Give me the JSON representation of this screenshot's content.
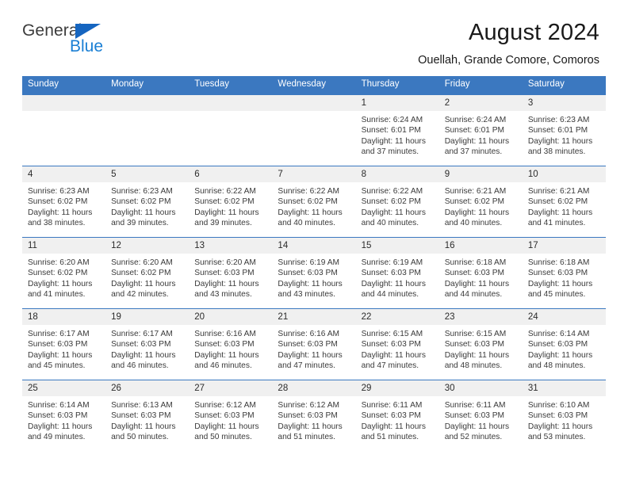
{
  "brand": {
    "general": "General",
    "blue": "Blue",
    "flag_icon": "triangle-flag-icon",
    "accent_color": "#1a7fd4"
  },
  "header": {
    "title": "August 2024",
    "location": "Ouellah, Grande Comore, Comoros"
  },
  "theme": {
    "header_blue": "#3b78c0",
    "daynum_bg": "#f0f0f0",
    "text": "#3a3a3a"
  },
  "weekday_headers": [
    "Sunday",
    "Monday",
    "Tuesday",
    "Wednesday",
    "Thursday",
    "Friday",
    "Saturday"
  ],
  "weeks": [
    [
      {
        "day": "",
        "sunrise": "",
        "sunset": "",
        "daylight_line1": "",
        "daylight_line2": ""
      },
      {
        "day": "",
        "sunrise": "",
        "sunset": "",
        "daylight_line1": "",
        "daylight_line2": ""
      },
      {
        "day": "",
        "sunrise": "",
        "sunset": "",
        "daylight_line1": "",
        "daylight_line2": ""
      },
      {
        "day": "",
        "sunrise": "",
        "sunset": "",
        "daylight_line1": "",
        "daylight_line2": ""
      },
      {
        "day": "1",
        "sunrise": "Sunrise: 6:24 AM",
        "sunset": "Sunset: 6:01 PM",
        "daylight_line1": "Daylight: 11 hours",
        "daylight_line2": "and 37 minutes."
      },
      {
        "day": "2",
        "sunrise": "Sunrise: 6:24 AM",
        "sunset": "Sunset: 6:01 PM",
        "daylight_line1": "Daylight: 11 hours",
        "daylight_line2": "and 37 minutes."
      },
      {
        "day": "3",
        "sunrise": "Sunrise: 6:23 AM",
        "sunset": "Sunset: 6:01 PM",
        "daylight_line1": "Daylight: 11 hours",
        "daylight_line2": "and 38 minutes."
      }
    ],
    [
      {
        "day": "4",
        "sunrise": "Sunrise: 6:23 AM",
        "sunset": "Sunset: 6:02 PM",
        "daylight_line1": "Daylight: 11 hours",
        "daylight_line2": "and 38 minutes."
      },
      {
        "day": "5",
        "sunrise": "Sunrise: 6:23 AM",
        "sunset": "Sunset: 6:02 PM",
        "daylight_line1": "Daylight: 11 hours",
        "daylight_line2": "and 39 minutes."
      },
      {
        "day": "6",
        "sunrise": "Sunrise: 6:22 AM",
        "sunset": "Sunset: 6:02 PM",
        "daylight_line1": "Daylight: 11 hours",
        "daylight_line2": "and 39 minutes."
      },
      {
        "day": "7",
        "sunrise": "Sunrise: 6:22 AM",
        "sunset": "Sunset: 6:02 PM",
        "daylight_line1": "Daylight: 11 hours",
        "daylight_line2": "and 40 minutes."
      },
      {
        "day": "8",
        "sunrise": "Sunrise: 6:22 AM",
        "sunset": "Sunset: 6:02 PM",
        "daylight_line1": "Daylight: 11 hours",
        "daylight_line2": "and 40 minutes."
      },
      {
        "day": "9",
        "sunrise": "Sunrise: 6:21 AM",
        "sunset": "Sunset: 6:02 PM",
        "daylight_line1": "Daylight: 11 hours",
        "daylight_line2": "and 40 minutes."
      },
      {
        "day": "10",
        "sunrise": "Sunrise: 6:21 AM",
        "sunset": "Sunset: 6:02 PM",
        "daylight_line1": "Daylight: 11 hours",
        "daylight_line2": "and 41 minutes."
      }
    ],
    [
      {
        "day": "11",
        "sunrise": "Sunrise: 6:20 AM",
        "sunset": "Sunset: 6:02 PM",
        "daylight_line1": "Daylight: 11 hours",
        "daylight_line2": "and 41 minutes."
      },
      {
        "day": "12",
        "sunrise": "Sunrise: 6:20 AM",
        "sunset": "Sunset: 6:02 PM",
        "daylight_line1": "Daylight: 11 hours",
        "daylight_line2": "and 42 minutes."
      },
      {
        "day": "13",
        "sunrise": "Sunrise: 6:20 AM",
        "sunset": "Sunset: 6:03 PM",
        "daylight_line1": "Daylight: 11 hours",
        "daylight_line2": "and 43 minutes."
      },
      {
        "day": "14",
        "sunrise": "Sunrise: 6:19 AM",
        "sunset": "Sunset: 6:03 PM",
        "daylight_line1": "Daylight: 11 hours",
        "daylight_line2": "and 43 minutes."
      },
      {
        "day": "15",
        "sunrise": "Sunrise: 6:19 AM",
        "sunset": "Sunset: 6:03 PM",
        "daylight_line1": "Daylight: 11 hours",
        "daylight_line2": "and 44 minutes."
      },
      {
        "day": "16",
        "sunrise": "Sunrise: 6:18 AM",
        "sunset": "Sunset: 6:03 PM",
        "daylight_line1": "Daylight: 11 hours",
        "daylight_line2": "and 44 minutes."
      },
      {
        "day": "17",
        "sunrise": "Sunrise: 6:18 AM",
        "sunset": "Sunset: 6:03 PM",
        "daylight_line1": "Daylight: 11 hours",
        "daylight_line2": "and 45 minutes."
      }
    ],
    [
      {
        "day": "18",
        "sunrise": "Sunrise: 6:17 AM",
        "sunset": "Sunset: 6:03 PM",
        "daylight_line1": "Daylight: 11 hours",
        "daylight_line2": "and 45 minutes."
      },
      {
        "day": "19",
        "sunrise": "Sunrise: 6:17 AM",
        "sunset": "Sunset: 6:03 PM",
        "daylight_line1": "Daylight: 11 hours",
        "daylight_line2": "and 46 minutes."
      },
      {
        "day": "20",
        "sunrise": "Sunrise: 6:16 AM",
        "sunset": "Sunset: 6:03 PM",
        "daylight_line1": "Daylight: 11 hours",
        "daylight_line2": "and 46 minutes."
      },
      {
        "day": "21",
        "sunrise": "Sunrise: 6:16 AM",
        "sunset": "Sunset: 6:03 PM",
        "daylight_line1": "Daylight: 11 hours",
        "daylight_line2": "and 47 minutes."
      },
      {
        "day": "22",
        "sunrise": "Sunrise: 6:15 AM",
        "sunset": "Sunset: 6:03 PM",
        "daylight_line1": "Daylight: 11 hours",
        "daylight_line2": "and 47 minutes."
      },
      {
        "day": "23",
        "sunrise": "Sunrise: 6:15 AM",
        "sunset": "Sunset: 6:03 PM",
        "daylight_line1": "Daylight: 11 hours",
        "daylight_line2": "and 48 minutes."
      },
      {
        "day": "24",
        "sunrise": "Sunrise: 6:14 AM",
        "sunset": "Sunset: 6:03 PM",
        "daylight_line1": "Daylight: 11 hours",
        "daylight_line2": "and 48 minutes."
      }
    ],
    [
      {
        "day": "25",
        "sunrise": "Sunrise: 6:14 AM",
        "sunset": "Sunset: 6:03 PM",
        "daylight_line1": "Daylight: 11 hours",
        "daylight_line2": "and 49 minutes."
      },
      {
        "day": "26",
        "sunrise": "Sunrise: 6:13 AM",
        "sunset": "Sunset: 6:03 PM",
        "daylight_line1": "Daylight: 11 hours",
        "daylight_line2": "and 50 minutes."
      },
      {
        "day": "27",
        "sunrise": "Sunrise: 6:12 AM",
        "sunset": "Sunset: 6:03 PM",
        "daylight_line1": "Daylight: 11 hours",
        "daylight_line2": "and 50 minutes."
      },
      {
        "day": "28",
        "sunrise": "Sunrise: 6:12 AM",
        "sunset": "Sunset: 6:03 PM",
        "daylight_line1": "Daylight: 11 hours",
        "daylight_line2": "and 51 minutes."
      },
      {
        "day": "29",
        "sunrise": "Sunrise: 6:11 AM",
        "sunset": "Sunset: 6:03 PM",
        "daylight_line1": "Daylight: 11 hours",
        "daylight_line2": "and 51 minutes."
      },
      {
        "day": "30",
        "sunrise": "Sunrise: 6:11 AM",
        "sunset": "Sunset: 6:03 PM",
        "daylight_line1": "Daylight: 11 hours",
        "daylight_line2": "and 52 minutes."
      },
      {
        "day": "31",
        "sunrise": "Sunrise: 6:10 AM",
        "sunset": "Sunset: 6:03 PM",
        "daylight_line1": "Daylight: 11 hours",
        "daylight_line2": "and 53 minutes."
      }
    ]
  ]
}
